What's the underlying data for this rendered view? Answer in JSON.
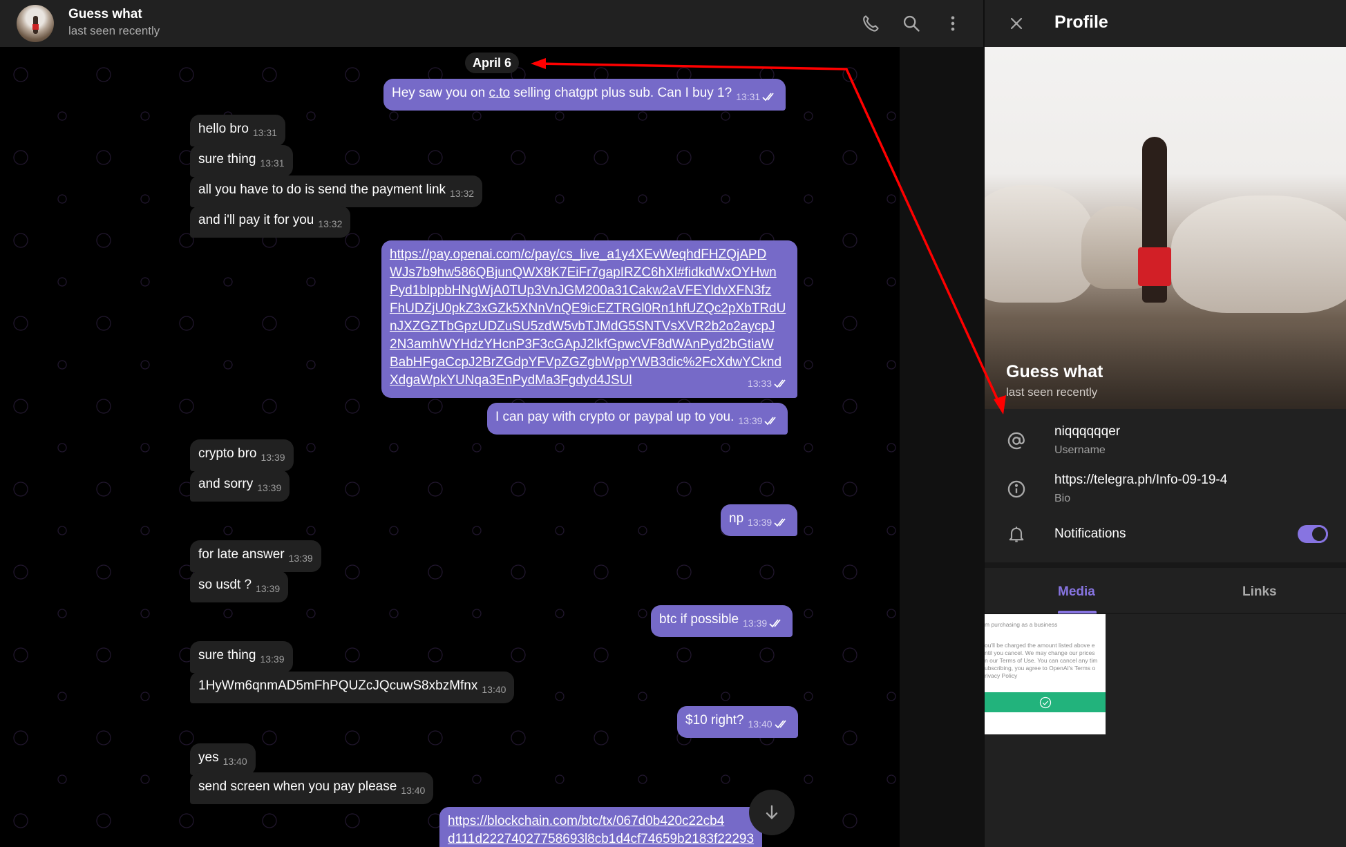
{
  "chat": {
    "title": "Guess what",
    "status": "last seen recently",
    "icons": {
      "call": "phone-icon",
      "search": "search-icon",
      "menu": "more-vertical-icon"
    },
    "date_badge": "April 6",
    "messages": [
      {
        "dir": "out",
        "text_before": "Hey saw you on ",
        "link": "c.to",
        "text_after": " selling chatgpt plus sub. Can I buy 1?",
        "time": "13:31",
        "read": true
      },
      {
        "dir": "in",
        "text": "hello bro",
        "time": "13:31"
      },
      {
        "dir": "in",
        "text": "sure thing",
        "time": "13:31"
      },
      {
        "dir": "in",
        "text": "all you have to do is send the payment link",
        "time": "13:32"
      },
      {
        "dir": "in",
        "text": "and i'll pay it for you",
        "time": "13:32"
      },
      {
        "dir": "out",
        "link_lines": [
          "https://pay.openai.com/c/pay/cs_live_a1y4XEvWeqhdFHZQjAPD",
          "WJs7b9hw586QBjunQWX8K7EiFr7gapIRZC6hXl#fidkdWxOYHwn",
          "Pyd1blppbHNgWjA0TUp3VnJGM200a31Cakw2aVFEYldvXFN3fz",
          "FhUDZjU0pkZ3xGZk5XNnVnQE9icEZTRGl0Rn1hfUZQc2pXbTRdU",
          "nJXZGZTbGpzUDZuSU5zdW5vbTJMdG5SNTVsXVR2b2o2aycpJ",
          "2N3amhWYHdzYHcnP3F3cGApJ2lkfGpwcVF8dWAnPyd2bGtiaW",
          "BabHFgaCcpJ2BrZGdpYFVpZGZgbWppYWB3dic%2FcXdwYCknd",
          "XdgaWpkYUNqa3EnPydMa3Fgdyd4JSUl"
        ],
        "time": "13:33",
        "read": true
      },
      {
        "dir": "out",
        "text": "I can pay with crypto or paypal up to you.",
        "time": "13:39",
        "read": true
      },
      {
        "dir": "in",
        "text": "crypto bro",
        "time": "13:39"
      },
      {
        "dir": "in",
        "text": "and sorry",
        "time": "13:39"
      },
      {
        "dir": "out",
        "text": "np",
        "time": "13:39",
        "read": true
      },
      {
        "dir": "in",
        "text": "for late answer",
        "time": "13:39"
      },
      {
        "dir": "in",
        "text": "so usdt ?",
        "time": "13:39"
      },
      {
        "dir": "out",
        "text": "btc if possible",
        "time": "13:39",
        "read": true
      },
      {
        "dir": "in",
        "text": "sure thing",
        "time": "13:39"
      },
      {
        "dir": "in",
        "text": "1HyWm6qnmAD5mFhPQUZcJQcuwS8xbzMfnx",
        "time": "13:40"
      },
      {
        "dir": "out",
        "text": "$10 right?",
        "time": "13:40",
        "read": true
      },
      {
        "dir": "in",
        "text": "yes",
        "time": "13:40"
      },
      {
        "dir": "in",
        "text": "send screen when you pay please",
        "time": "13:40"
      },
      {
        "dir": "out",
        "link_lines": [
          "https://blockchain.com/btc/tx/067d0b420c22cb4",
          "d111d22274027758693l8cb1d4cf74659b2183f22293"
        ],
        "partial": true
      }
    ],
    "scroll_down_icon": "arrow-down-icon"
  },
  "profile": {
    "title": "Profile",
    "close_icon": "close-icon",
    "name": "Guess what",
    "status": "last seen recently",
    "username": {
      "value": "niqqqqqqer",
      "label": "Username",
      "icon": "at-icon"
    },
    "bio": {
      "value": "https://telegra.ph/Info-09-19-4",
      "label": "Bio",
      "icon": "info-icon"
    },
    "notifications": {
      "label": "Notifications",
      "icon": "bell-icon",
      "enabled": true
    },
    "tabs": [
      {
        "label": "Media",
        "active": true
      },
      {
        "label": "Links",
        "active": false
      }
    ],
    "media_thumb": {
      "lines": [
        "m purchasing as a business",
        "ou'll be charged the amount listed above e",
        "ntil you cancel. We may change our prices",
        "n our Terms of Use. You can cancel any tim",
        "ubscribing, you agree to OpenAI's Terms o",
        "rivacy Policy"
      ]
    }
  },
  "colors": {
    "accent": "#8774e1",
    "outgoing_bubble": "#766ac8",
    "incoming_bubble": "#212121",
    "panel_bg": "#212121",
    "chat_bg": "#000000",
    "annotation_arrow": "#ff0000",
    "thumb_button": "#22b37c"
  }
}
